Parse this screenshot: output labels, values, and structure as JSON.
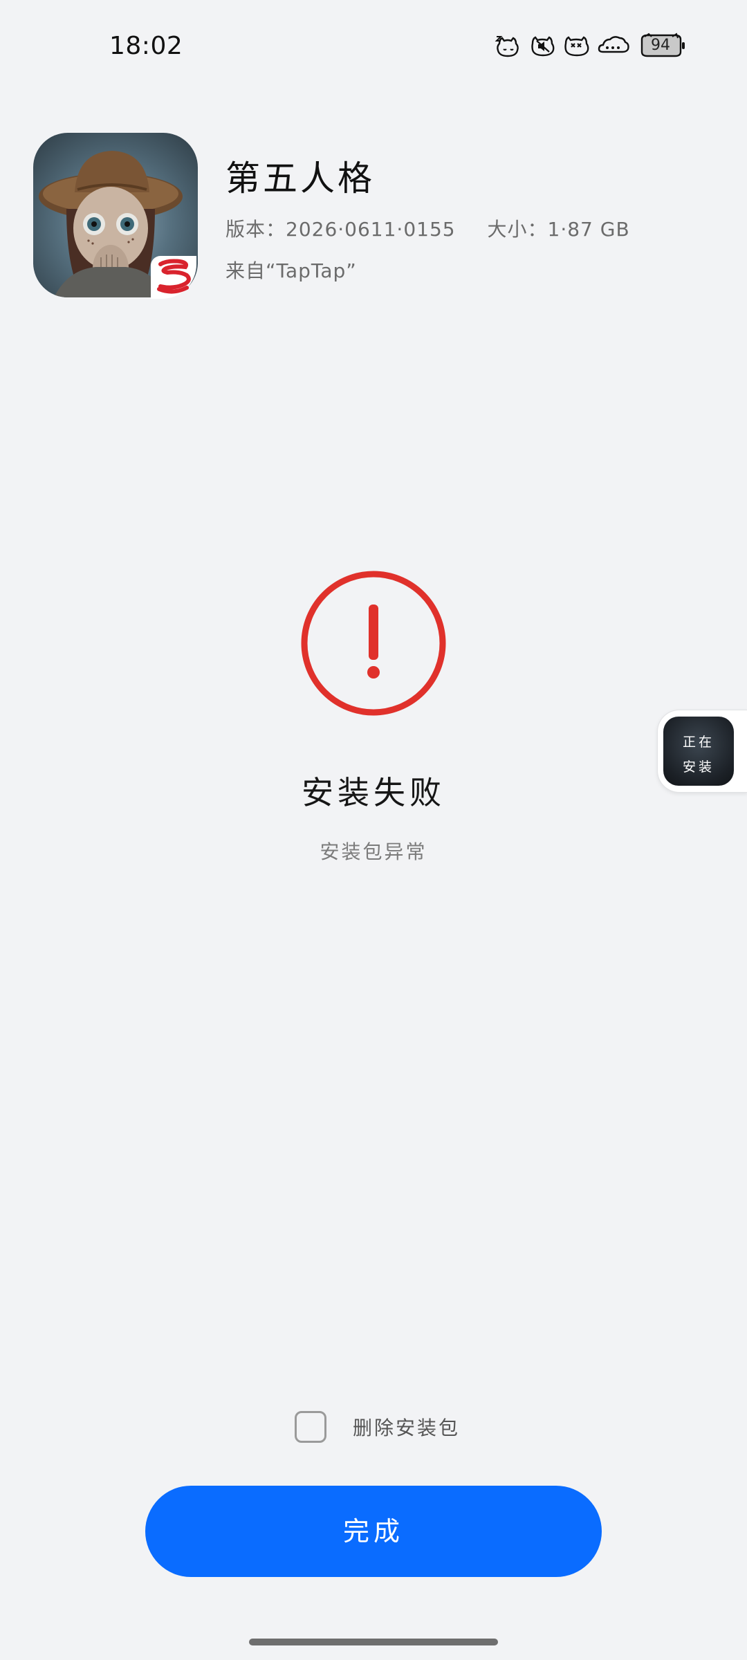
{
  "status_bar": {
    "time": "18:02",
    "battery": "94",
    "icons": [
      "sleep-cat-icon",
      "mute-icon",
      "no-notification-icon",
      "wifi-cloud-icon",
      "battery-icon"
    ]
  },
  "app": {
    "name": "第五人格",
    "version_label": "版本：",
    "version": "2026·0611·0155",
    "size_label": "大小：",
    "size": "1·87 GB",
    "source": "来自“TapTap”",
    "icon": "app-icon",
    "badge_icon": "netease-logo-icon"
  },
  "result": {
    "icon": "error-icon",
    "accent_color": "#e0312b",
    "title": "安装失败",
    "subtitle": "安装包异常"
  },
  "floating_bubble": {
    "line1": "正在",
    "line2": "安装"
  },
  "footer": {
    "delete_label": "删除安装包",
    "delete_checked": false,
    "done_label": "完成",
    "button_color": "#0a6cff"
  }
}
